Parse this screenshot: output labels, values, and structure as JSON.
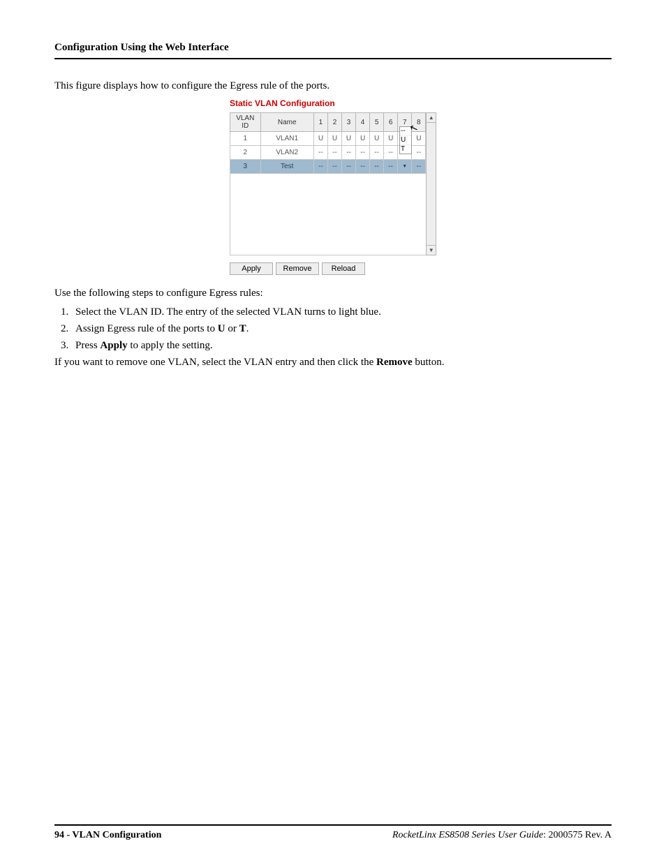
{
  "header": {
    "running": "Configuration Using the Web Interface"
  },
  "intro": "This figure displays how to configure the Egress rule of the ports.",
  "screenshot": {
    "title": "Static VLAN Configuration",
    "cols": {
      "id": "VLAN ID",
      "name": "Name",
      "ports": [
        "1",
        "2",
        "3",
        "4",
        "5",
        "6",
        "7",
        "8"
      ]
    },
    "rows": [
      {
        "id": "1",
        "name": "VLAN1",
        "cells": [
          "U",
          "U",
          "U",
          "U",
          "U",
          "U",
          "U",
          "U"
        ],
        "selected": false
      },
      {
        "id": "2",
        "name": "VLAN2",
        "cells": [
          "--",
          "--",
          "--",
          "--",
          "--",
          "--",
          "--",
          "--"
        ],
        "selected": false
      },
      {
        "id": "3",
        "name": "Test",
        "cells": [
          "--",
          "--",
          "--",
          "--",
          "--",
          "--",
          "▼",
          "--"
        ],
        "selected": true
      }
    ],
    "dropdown": {
      "options": [
        "--",
        "U",
        "T"
      ]
    },
    "buttons": {
      "apply": "Apply",
      "remove": "Remove",
      "reload": "Reload"
    },
    "scroll": {
      "up": "▲",
      "down": "▼"
    }
  },
  "steps_intro": "Use the following steps to configure Egress rules:",
  "steps": [
    {
      "pre": "Select the VLAN ID. The entry of the selected VLAN turns to light blue."
    },
    {
      "pre": "Assign Egress rule of the ports to ",
      "bold1": "U",
      "mid": " or ",
      "bold2": "T",
      "post": "."
    },
    {
      "pre": "Press ",
      "bold1": "Apply",
      "post": " to apply the setting."
    }
  ],
  "after_steps": {
    "pre": "If you want to remove one VLAN, select the VLAN entry and then click the ",
    "bold": "Remove",
    "post": " button."
  },
  "footer": {
    "page_num": "94",
    "section": "VLAN Configuration",
    "product": "RocketLinx ES8508 Series  User Guide",
    "doc": "2000575 Rev. A"
  }
}
